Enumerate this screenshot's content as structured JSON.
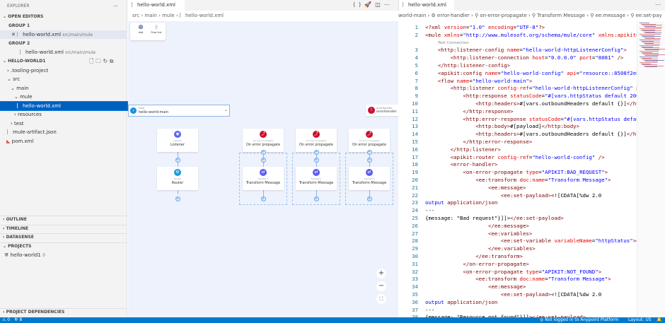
{
  "sidebar": {
    "title": "EXPLORER",
    "more": "···",
    "open_editors": "OPEN EDITORS",
    "group1": "GROUP 1",
    "group2": "GROUP 2",
    "open_files": [
      {
        "name": "hello-world.xml",
        "path": "src/main/mule"
      },
      {
        "name": "hello-world.xml",
        "path": "src/main/mule"
      }
    ],
    "project": "HELLO-WORLD1",
    "tree": [
      ".tooling-project",
      "src",
      "main",
      "mule",
      "hello-world.xml",
      "resources",
      "test",
      "mule-artifact.json",
      "pom.xml"
    ],
    "sections": [
      "OUTLINE",
      "TIMELINE",
      "DATASENSE",
      "PROJECTS",
      "PROJECT DEPENDENCIES"
    ],
    "projects_item": "hello-world1",
    "projects_count": "0"
  },
  "canvas": {
    "tab": "hello-world.xml",
    "breadcrumb": [
      "src",
      "main",
      "mule",
      "hello-world.xml"
    ],
    "tools": {
      "add": "Add",
      "flow_list": "Flow List"
    },
    "flow": {
      "kind": "Flow",
      "name": "hello-world-main"
    },
    "error_handler": {
      "kind": "errorHandler",
      "name": "errorHandler"
    },
    "nodes": [
      {
        "sub": "Listener",
        "label": "Listener",
        "color": "#5b63ee"
      },
      {
        "sub": "Router",
        "label": "Router",
        "color": "#1a9be0"
      }
    ],
    "errors": [
      {
        "sub": "On error propagate",
        "label": "On error propagate",
        "t_sub": "Transform",
        "t_label": "Transform Message"
      },
      {
        "sub": "On error propagate",
        "label": "On error propagate",
        "t_sub": "Transform",
        "t_label": "Transform Message"
      },
      {
        "sub": "On error propagate",
        "label": "On error propagate",
        "t_sub": "Transform",
        "t_label": "Transform Message"
      }
    ],
    "colors": {
      "error": "#c8102e",
      "transform": "#5b5bf0"
    }
  },
  "editor": {
    "tab": "hello-world.xml",
    "breadcrumb": "world-main  ›  ⚙ error-handler  ›  ⚲ on-error-propagate  ›  ⚲ Transform Message  ›  ⚲ ee:message  ›  ⚲ ee:set-pay",
    "codelens": "Test Connection",
    "lines": [
      [
        [
          "t",
          "<?xml "
        ],
        [
          "a",
          "version"
        ],
        [
          "x",
          "="
        ],
        [
          "v",
          "\"1.0\""
        ],
        [
          "a",
          " encoding"
        ],
        [
          "x",
          "="
        ],
        [
          "v",
          "\"UTF-8\""
        ],
        [
          "t",
          "?>"
        ]
      ],
      [
        [
          "t",
          "<mule "
        ],
        [
          "a",
          "xmlns"
        ],
        [
          "x",
          "="
        ],
        [
          "v",
          "\"http://www.mulesoft.org/schema/mule/core\""
        ],
        [
          "a",
          " xmlns:apikit"
        ],
        [
          "x",
          "="
        ]
      ],
      [
        [
          "x",
          "    "
        ],
        [
          "t",
          "<http:listener-config "
        ],
        [
          "a",
          "name"
        ],
        [
          "x",
          "="
        ],
        [
          "v",
          "\"hello-world-httpListenerConfig\""
        ],
        [
          "t",
          ">"
        ]
      ],
      [
        [
          "x",
          "        "
        ],
        [
          "t",
          "<http:listener-connection "
        ],
        [
          "a",
          "host"
        ],
        [
          "x",
          "="
        ],
        [
          "v",
          "\"0.0.0.0\""
        ],
        [
          "a",
          " port"
        ],
        [
          "x",
          "="
        ],
        [
          "v",
          "\"8081\""
        ],
        [
          "t",
          " />"
        ]
      ],
      [
        [
          "x",
          "    "
        ],
        [
          "t",
          "</http:listener-config>"
        ]
      ],
      [
        [
          "x",
          "    "
        ],
        [
          "t",
          "<apikit:config "
        ],
        [
          "a",
          "name"
        ],
        [
          "x",
          "="
        ],
        [
          "v",
          "\"hello-world-config\""
        ],
        [
          "a",
          " api"
        ],
        [
          "x",
          "="
        ],
        [
          "v",
          "\"resource::8508f2e8"
        ]
      ],
      [
        [
          "x",
          "    "
        ],
        [
          "t",
          "<flow "
        ],
        [
          "a",
          "name"
        ],
        [
          "x",
          "="
        ],
        [
          "v",
          "\"hello-world-main\""
        ],
        [
          "t",
          ">"
        ]
      ],
      [
        [
          "x",
          "        "
        ],
        [
          "t",
          "<http:listener "
        ],
        [
          "a",
          "config-ref"
        ],
        [
          "x",
          "="
        ],
        [
          "v",
          "\"hello-world-httpListenerConfig\""
        ],
        [
          "a",
          " p"
        ]
      ],
      [
        [
          "x",
          "            "
        ],
        [
          "t",
          "<http:response "
        ],
        [
          "a",
          "statusCode"
        ],
        [
          "x",
          "="
        ],
        [
          "v",
          "\"#[vars.httpStatus default 200"
        ]
      ],
      [
        [
          "x",
          "                "
        ],
        [
          "t",
          "<http:headers>"
        ],
        [
          "x",
          "#[vars.outboundHeaders default {}]"
        ],
        [
          "t",
          "</ht"
        ]
      ],
      [
        [
          "x",
          "            "
        ],
        [
          "t",
          "</http:response>"
        ]
      ],
      [
        [
          "x",
          "            "
        ],
        [
          "t",
          "<http:error-response "
        ],
        [
          "a",
          "statusCode"
        ],
        [
          "x",
          "="
        ],
        [
          "v",
          "\"#[vars.httpStatus defau"
        ]
      ],
      [
        [
          "x",
          "                "
        ],
        [
          "t",
          "<http:body>"
        ],
        [
          "x",
          "#[payload]"
        ],
        [
          "t",
          "</http:body>"
        ]
      ],
      [
        [
          "x",
          "                "
        ],
        [
          "t",
          "<http:headers>"
        ],
        [
          "x",
          "#[vars.outboundHeaders default {}]"
        ],
        [
          "t",
          "</ht"
        ]
      ],
      [
        [
          "x",
          "            "
        ],
        [
          "t",
          "</http:error-response>"
        ]
      ],
      [
        [
          "x",
          "        "
        ],
        [
          "t",
          "</http:listener>"
        ]
      ],
      [
        [
          "x",
          "        "
        ],
        [
          "t",
          "<apikit:router "
        ],
        [
          "a",
          "config-ref"
        ],
        [
          "x",
          "="
        ],
        [
          "v",
          "\"hello-world-config\""
        ],
        [
          "t",
          " />"
        ]
      ],
      [
        [
          "x",
          "        "
        ],
        [
          "t",
          "<error-handler>"
        ]
      ],
      [
        [
          "x",
          "            "
        ],
        [
          "t",
          "<on-error-propagate "
        ],
        [
          "a",
          "type"
        ],
        [
          "x",
          "="
        ],
        [
          "v",
          "\"APIKIT:BAD_REQUEST\""
        ],
        [
          "t",
          ">"
        ]
      ],
      [
        [
          "x",
          "                "
        ],
        [
          "t",
          "<ee:transform "
        ],
        [
          "a",
          "doc:name"
        ],
        [
          "x",
          "="
        ],
        [
          "v",
          "\"Transform Message\""
        ],
        [
          "t",
          ">"
        ]
      ],
      [
        [
          "x",
          "                    "
        ],
        [
          "t",
          "<ee:message>"
        ]
      ],
      [
        [
          "x",
          "                        "
        ],
        [
          "t",
          "<ee:set-payload>"
        ],
        [
          "x",
          "<![CDATA[%dw 2.0"
        ]
      ],
      [
        [
          "k",
          "output "
        ],
        [
          "t",
          "application/json"
        ]
      ],
      [
        [
          "x",
          "---"
        ]
      ],
      [
        [
          "x",
          "{message: \"Bad request\"}]]>"
        ],
        [
          "t",
          "</ee:set-payload>"
        ]
      ],
      [
        [
          "x",
          "                    "
        ],
        [
          "t",
          "</ee:message>"
        ]
      ],
      [
        [
          "x",
          "                    "
        ],
        [
          "t",
          "<ee:variables>"
        ]
      ],
      [
        [
          "x",
          "                        "
        ],
        [
          "t",
          "<ee:set-variable "
        ],
        [
          "a",
          "variableName"
        ],
        [
          "x",
          "="
        ],
        [
          "v",
          "\"httpStatus\""
        ],
        [
          "t",
          ">"
        ],
        [
          "x",
          "4"
        ]
      ],
      [
        [
          "x",
          "                    "
        ],
        [
          "t",
          "</ee:variables>"
        ]
      ],
      [
        [
          "x",
          "                "
        ],
        [
          "t",
          "</ee:transform>"
        ]
      ],
      [
        [
          "x",
          "            "
        ],
        [
          "t",
          "</on-error-propagate>"
        ]
      ],
      [
        [
          "x",
          "            "
        ],
        [
          "t",
          "<on-error-propagate "
        ],
        [
          "a",
          "type"
        ],
        [
          "x",
          "="
        ],
        [
          "v",
          "\"APIKIT:NOT_FOUND\""
        ],
        [
          "t",
          ">"
        ]
      ],
      [
        [
          "x",
          "                "
        ],
        [
          "t",
          "<ee:transform "
        ],
        [
          "a",
          "doc:name"
        ],
        [
          "x",
          "="
        ],
        [
          "v",
          "\"Transform Message\""
        ],
        [
          "t",
          ">"
        ]
      ],
      [
        [
          "x",
          "                    "
        ],
        [
          "t",
          "<ee:message>"
        ]
      ],
      [
        [
          "x",
          "                        "
        ],
        [
          "t",
          "<ee:set-payload>"
        ],
        [
          "x",
          "<![CDATA[%dw 2.0"
        ]
      ],
      [
        [
          "k",
          "output "
        ],
        [
          "t",
          "application/json"
        ]
      ],
      [
        [
          "x",
          "---"
        ]
      ],
      [
        [
          "x",
          "{message: \"Resource not found\"}]]>"
        ],
        [
          "t",
          "</ee:set-payload>"
        ]
      ]
    ]
  },
  "status": {
    "warnings": "⚠ 0",
    "ports": "8",
    "login": "Not logged in to Anypoint Platform",
    "layout": "Layout: US"
  }
}
